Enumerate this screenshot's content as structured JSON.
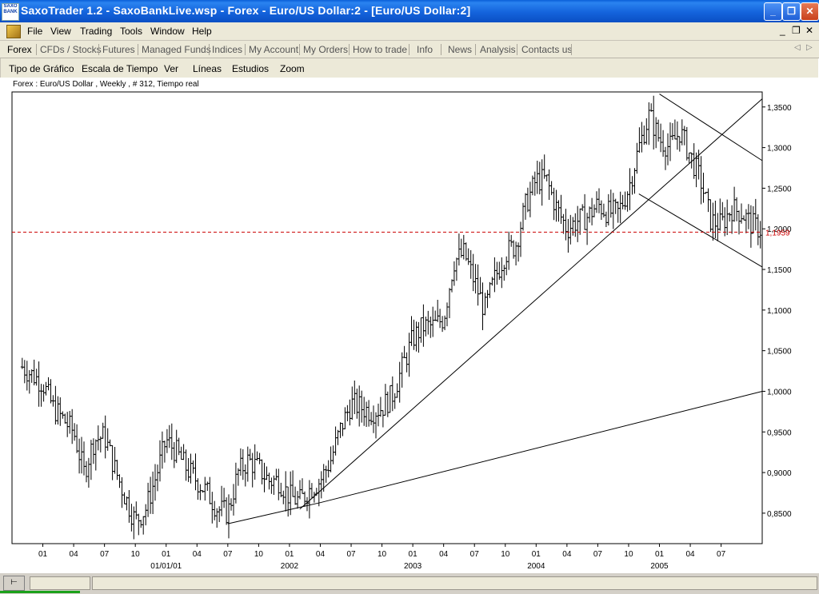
{
  "window": {
    "title": "SaxoTrader 1.2 - SaxoBankLive.wsp - Forex - Euro/US Dollar:2 - [Euro/US Dollar:2]",
    "app_icon_text": "SAXO BANK",
    "minimize_glyph": "_",
    "restore_glyph": "❐",
    "close_glyph": "✕"
  },
  "menubar": {
    "items": [
      "File",
      "View",
      "Trading",
      "Tools",
      "Window",
      "Help"
    ],
    "mdi_minimize": "_",
    "mdi_restore": "❐",
    "mdi_close": "✕"
  },
  "navbar": {
    "items": [
      "Forex",
      "CFDs / Stocks",
      "Futures",
      "Managed Funds",
      "Indices",
      "My Account",
      "My Orders",
      "How to trade",
      "Info",
      "News",
      "Analysis",
      "Contacts us"
    ],
    "active": "Forex",
    "scroll_left": "◁",
    "scroll_right": "▷"
  },
  "chart_menu": {
    "items": [
      "Tipo de Gráfico",
      "Escala de Tiempo",
      "Ver",
      "Líneas",
      "Estudios",
      "Zoom"
    ]
  },
  "chart_info": "Forex : Euro/US Dollar , Weekly , # 312, Tiempo real",
  "colors": {
    "titlebar": "#0a5fd8",
    "bars": "#000000",
    "current_price_line": "#cc0000",
    "current_price_label": "#cc0000"
  },
  "chart_data": {
    "type": "ohlc",
    "symbol": "Euro/US Dollar",
    "timeframe": "Weekly",
    "y_ticks": [
      "1,3500",
      "1,3000",
      "1,2500",
      "1,2000",
      "1,1500",
      "1,1000",
      "1,0500",
      "1,0000",
      "0,9500",
      "0,9000",
      "0,8500"
    ],
    "y_tick_values": [
      1.35,
      1.3,
      1.25,
      1.2,
      1.15,
      1.1,
      1.05,
      1.0,
      0.95,
      0.9,
      0.85
    ],
    "ylim": [
      0.8125,
      1.3685
    ],
    "x_tick_labels": [
      "01",
      "04",
      "07",
      "10",
      "01",
      "04",
      "07",
      "10",
      "01",
      "04",
      "07",
      "10",
      "01",
      "04",
      "07",
      "10",
      "01",
      "04",
      "07",
      "10",
      "01",
      "04",
      "07"
    ],
    "x_tick_dates": [
      "2000-01",
      "2000-04",
      "2000-07",
      "2000-10",
      "2001-01",
      "2001-04",
      "2001-07",
      "2001-10",
      "2002-01",
      "2002-04",
      "2002-07",
      "2002-10",
      "2003-01",
      "2003-04",
      "2003-07",
      "2003-10",
      "2004-01",
      "2004-04",
      "2004-07",
      "2004-10",
      "2005-01",
      "2005-04",
      "2005-07"
    ],
    "x_period_labels": [
      {
        "date": "2001-01",
        "label": "01/01/01"
      },
      {
        "date": "2002-01",
        "label": "2002"
      },
      {
        "date": "2003-01",
        "label": "2003"
      },
      {
        "date": "2004-01",
        "label": "2004"
      },
      {
        "date": "2005-01",
        "label": "2005"
      }
    ],
    "xlim": [
      "1999-10",
      "2005-11"
    ],
    "current_price": 1.1959,
    "current_price_label": "1,1959",
    "price_path": [
      [
        "1999-11",
        1.03
      ],
      [
        "2000-01",
        1.01
      ],
      [
        "2000-02",
        0.98
      ],
      [
        "2000-03",
        0.965
      ],
      [
        "2000-04",
        0.95
      ],
      [
        "2000-05",
        0.9
      ],
      [
        "2000-06",
        0.94
      ],
      [
        "2000-07",
        0.945
      ],
      [
        "2000-08",
        0.905
      ],
      [
        "2000-09",
        0.87
      ],
      [
        "2000-10",
        0.84
      ],
      [
        "2000-11",
        0.855
      ],
      [
        "2000-12",
        0.895
      ],
      [
        "2001-01",
        0.94
      ],
      [
        "2001-02",
        0.925
      ],
      [
        "2001-03",
        0.905
      ],
      [
        "2001-04",
        0.89
      ],
      [
        "2001-05",
        0.875
      ],
      [
        "2001-06",
        0.855
      ],
      [
        "2001-07",
        0.85
      ],
      [
        "2001-08",
        0.9
      ],
      [
        "2001-09",
        0.915
      ],
      [
        "2001-10",
        0.905
      ],
      [
        "2001-11",
        0.89
      ],
      [
        "2001-12",
        0.89
      ],
      [
        "2002-01",
        0.87
      ],
      [
        "2002-02",
        0.865
      ],
      [
        "2002-03",
        0.88
      ],
      [
        "2002-04",
        0.89
      ],
      [
        "2002-05",
        0.915
      ],
      [
        "2002-06",
        0.955
      ],
      [
        "2002-07",
        0.985
      ],
      [
        "2002-08",
        0.98
      ],
      [
        "2002-09",
        0.975
      ],
      [
        "2002-10",
        0.98
      ],
      [
        "2002-11",
        0.995
      ],
      [
        "2002-12",
        1.03
      ],
      [
        "2003-01",
        1.065
      ],
      [
        "2003-02",
        1.08
      ],
      [
        "2003-03",
        1.08
      ],
      [
        "2003-04",
        1.09
      ],
      [
        "2003-05",
        1.16
      ],
      [
        "2003-06",
        1.17
      ],
      [
        "2003-07",
        1.135
      ],
      [
        "2003-08",
        1.1
      ],
      [
        "2003-09",
        1.14
      ],
      [
        "2003-10",
        1.17
      ],
      [
        "2003-11",
        1.18
      ],
      [
        "2003-12",
        1.23
      ],
      [
        "2004-01",
        1.26
      ],
      [
        "2004-02",
        1.26
      ],
      [
        "2004-03",
        1.225
      ],
      [
        "2004-04",
        1.2
      ],
      [
        "2004-05",
        1.21
      ],
      [
        "2004-06",
        1.215
      ],
      [
        "2004-07",
        1.23
      ],
      [
        "2004-08",
        1.22
      ],
      [
        "2004-09",
        1.22
      ],
      [
        "2004-10",
        1.25
      ],
      [
        "2004-11",
        1.3
      ],
      [
        "2004-12",
        1.34
      ],
      [
        "2005-01",
        1.31
      ],
      [
        "2005-02",
        1.3
      ],
      [
        "2005-03",
        1.32
      ],
      [
        "2005-04",
        1.29
      ],
      [
        "2005-05",
        1.26
      ],
      [
        "2005-06",
        1.21
      ],
      [
        "2005-07",
        1.205
      ],
      [
        "2005-08",
        1.225
      ],
      [
        "2005-09",
        1.22
      ],
      [
        "2005-10",
        1.205
      ],
      [
        "2005-11",
        1.198
      ]
    ],
    "trendlines": [
      {
        "from": [
          "2001-07",
          0.837
        ],
        "to": [
          "2002-04",
          0.863
        ]
      },
      {
        "from": [
          "2002-04",
          0.863
        ],
        "to": [
          "2005-11",
          1.0
        ]
      },
      {
        "from": [
          "2002-02",
          0.855
        ],
        "to": [
          "2005-11",
          1.36
        ]
      },
      {
        "from": [
          "2005-01",
          1.366
        ],
        "to": [
          "2005-11",
          1.284
        ]
      },
      {
        "from": [
          "2004-11",
          1.243
        ],
        "to": [
          "2005-11",
          1.153
        ]
      }
    ],
    "grid": false,
    "legend": "none"
  }
}
